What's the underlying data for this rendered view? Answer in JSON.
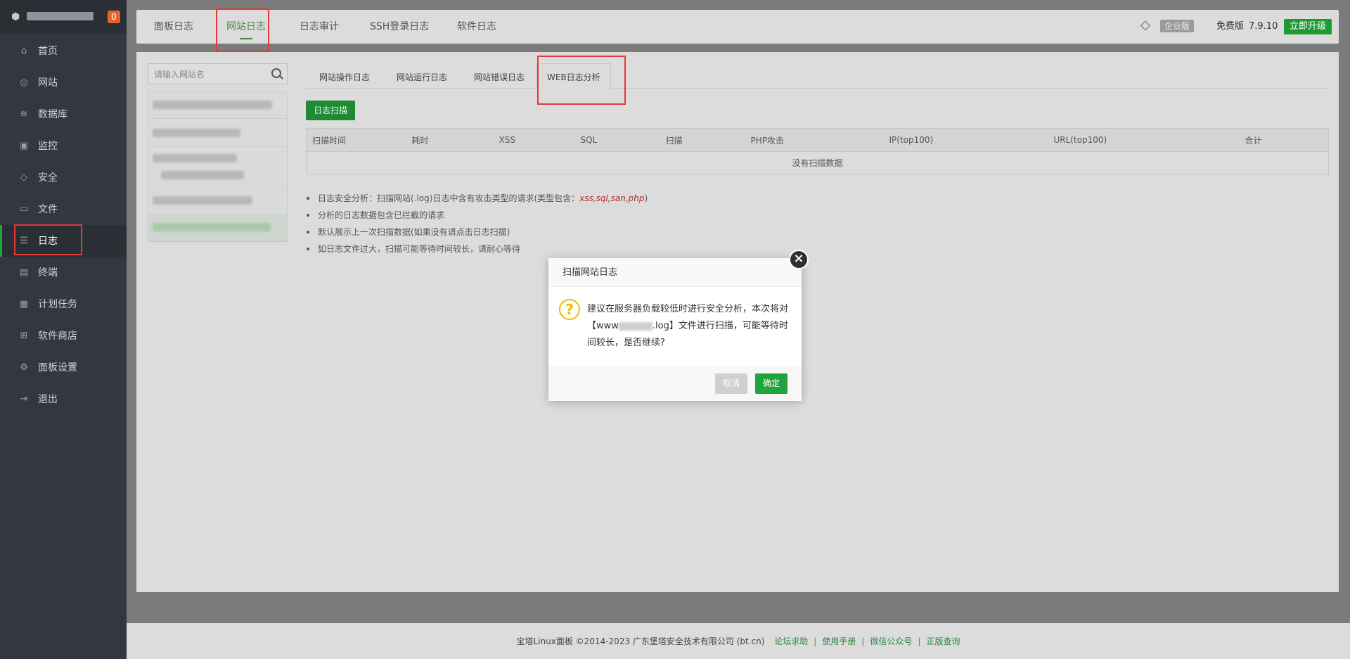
{
  "sidebar": {
    "badge": "0",
    "items": [
      {
        "label": "首页",
        "icon": "home-icon"
      },
      {
        "label": "网站",
        "icon": "globe-icon"
      },
      {
        "label": "数据库",
        "icon": "database-icon"
      },
      {
        "label": "监控",
        "icon": "monitor-icon"
      },
      {
        "label": "安全",
        "icon": "shield-icon"
      },
      {
        "label": "文件",
        "icon": "folder-icon"
      },
      {
        "label": "日志",
        "icon": "log-icon"
      },
      {
        "label": "终端",
        "icon": "terminal-icon"
      },
      {
        "label": "计划任务",
        "icon": "calendar-icon"
      },
      {
        "label": "软件商店",
        "icon": "grid-icon"
      },
      {
        "label": "面板设置",
        "icon": "gear-icon"
      },
      {
        "label": "退出",
        "icon": "logout-icon"
      }
    ],
    "active_index": 6
  },
  "topbar": {
    "tabs": [
      "面板日志",
      "网站日志",
      "日志审计",
      "SSH登录日志",
      "软件日志"
    ],
    "active_tab": "网站日志",
    "enterprise_label": "企业版",
    "free_label": "免费版",
    "version": "7.9.10",
    "upgrade_label": "立即升级"
  },
  "main": {
    "search_placeholder": "请输入网站名",
    "subtabs": [
      "网站操作日志",
      "网站运行日志",
      "网站错误日志",
      "WEB日志分析"
    ],
    "active_subtab": "WEB日志分析",
    "scan_button": "日志扫描",
    "table": {
      "headers": [
        "扫描时间",
        "耗时",
        "XSS",
        "SQL",
        "扫描",
        "PHP攻击",
        "IP(top100)",
        "URL(top100)",
        "合计"
      ],
      "empty_text": "没有扫描数据"
    },
    "notes": {
      "n1_prefix": "日志安全分析：扫描网站(.log)日志中含有攻击类型的请求(类型包含：",
      "n1_highlight": "xss,sql,san,php",
      "n1_suffix": ")",
      "n2": "分析的日志数据包含已拦截的请求",
      "n3": "默认展示上一次扫描数据(如果没有请点击日志扫描)",
      "n4": "如日志文件过大，扫描可能等待时间较长，请耐心等待"
    }
  },
  "dialog": {
    "title": "扫描网站日志",
    "close": "×",
    "icon": "?",
    "body_prefix": "建议在服务器负载较低时进行安全分析，本次将对【www",
    "body_suffix": ".log】文件进行扫描，可能等待时间较长，是否继续?",
    "cancel": "取消",
    "ok": "确定"
  },
  "footer": {
    "copyright": "宝塔Linux面板 ©2014-2023 广东堡塔安全技术有限公司 (bt.cn)",
    "links": [
      "论坛求助",
      "使用手册",
      "微信公众号",
      "正版查询"
    ]
  },
  "colors": {
    "accent": "#20a53a",
    "highlight_box": "#e53935",
    "sidebar_bg": "#323740"
  }
}
